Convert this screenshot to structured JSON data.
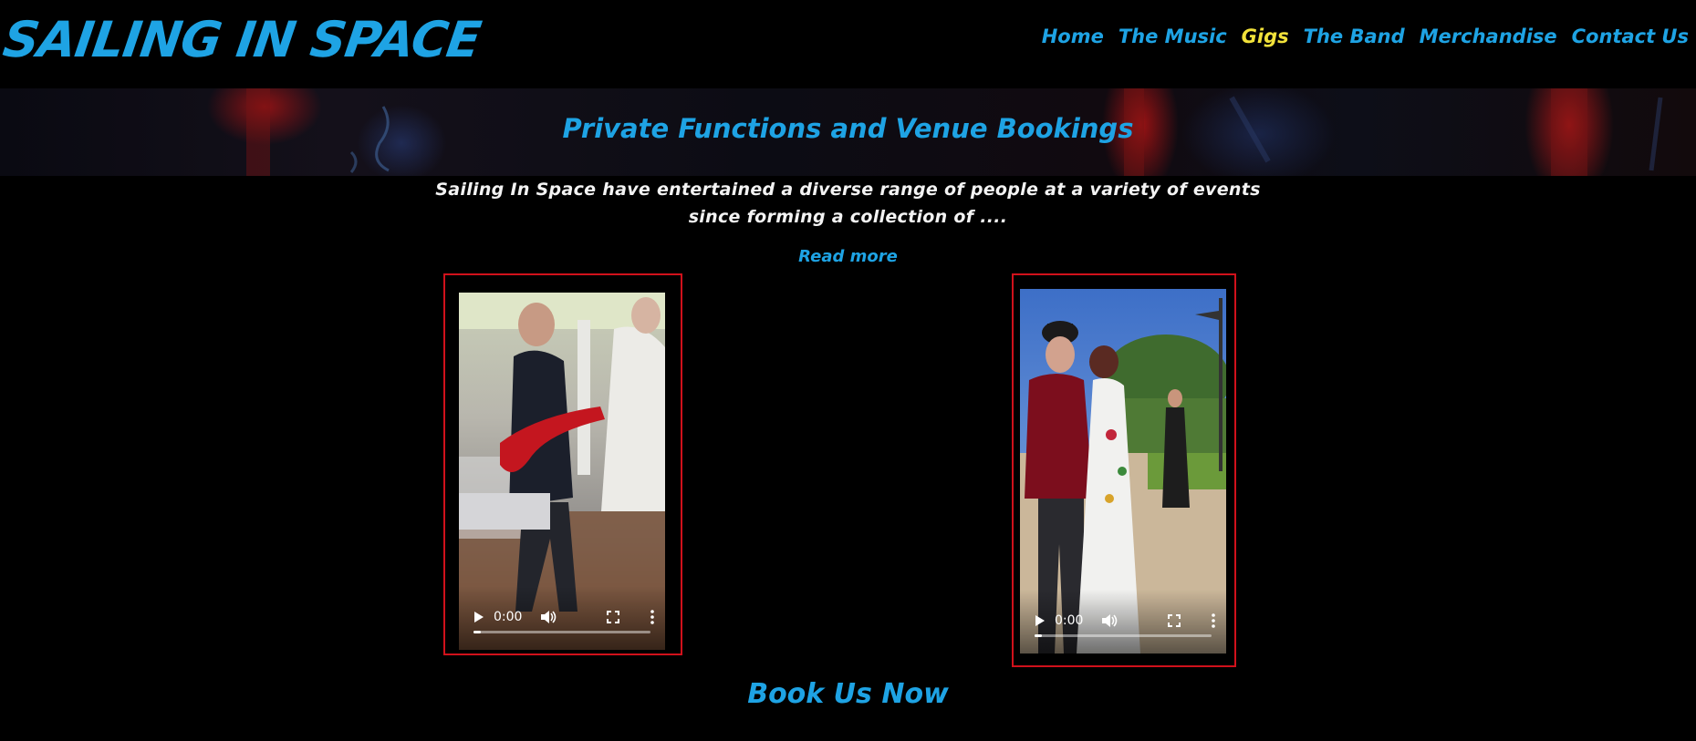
{
  "header": {
    "logo_text": "SAILING IN SPACE",
    "nav": [
      {
        "label": "Home"
      },
      {
        "label": "The Music"
      },
      {
        "label": "Gigs",
        "active": true
      },
      {
        "label": "The Band"
      },
      {
        "label": "Merchandise"
      },
      {
        "label": "Contact Us"
      }
    ]
  },
  "main": {
    "title": "Private Functions and Venue Bookings",
    "intro_line1": "Sailing In Space have entertained a diverse range of people at a variety of events",
    "intro_line2": "since forming a collection of ....",
    "read_more": "Read more",
    "videos": [
      {
        "time": "0:00",
        "progress": 0.04
      },
      {
        "time": "0:00",
        "progress": 0.04
      }
    ],
    "cta": "Book Us Now"
  },
  "colors": {
    "accent": "#1ea3e4",
    "active_nav": "#f2e23a",
    "frame_border": "#d0111b",
    "background": "#000000"
  }
}
